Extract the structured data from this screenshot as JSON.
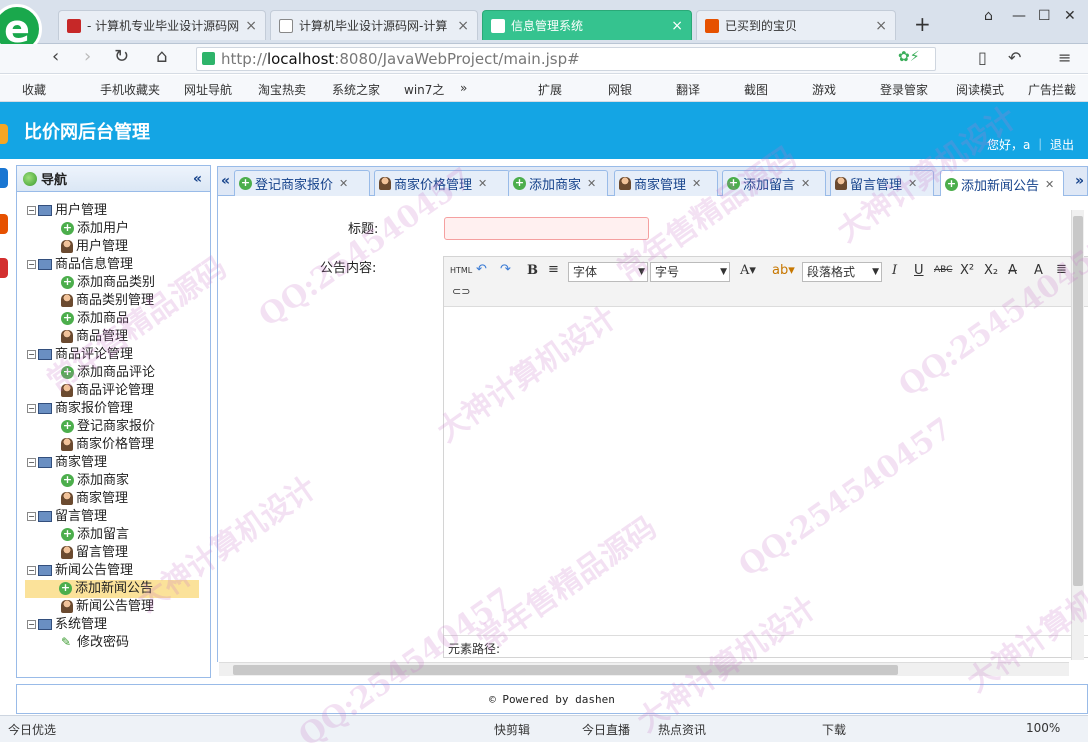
{
  "browser": {
    "tabs": [
      {
        "label": "- 计算机专业毕业设计源码网",
        "close": "×"
      },
      {
        "label": "计算机毕业设计源码网-计算",
        "close": "×"
      },
      {
        "label": "信息管理系统",
        "close": "×"
      },
      {
        "label": "已买到的宝贝",
        "close": "×"
      }
    ],
    "new_tab": "+",
    "url_prefix": "http://",
    "url_host": "localhost",
    "url_rest": ":8080/JavaWebProject/main.jsp#",
    "bookmarks": [
      "收藏",
      "手机收藏夹",
      "网址导航",
      "淘宝热卖",
      "系统之家",
      "win7之",
      "»",
      "扩展",
      "网银",
      "翻译",
      "截图",
      "游戏",
      "登录管家",
      "阅读模式",
      "广告拦截"
    ]
  },
  "app": {
    "title": "比价网后台管理",
    "welcome": "您好，a ｜ 退出"
  },
  "nav": {
    "title": "导航",
    "collapse": "«",
    "groups": [
      {
        "label": "用户管理",
        "items": [
          "添加用户",
          "用户管理"
        ]
      },
      {
        "label": "商品信息管理",
        "items": [
          "添加商品类别",
          "商品类别管理",
          "添加商品",
          "商品管理"
        ]
      },
      {
        "label": "商品评论管理",
        "items": [
          "添加商品评论",
          "商品评论管理"
        ]
      },
      {
        "label": "商家报价管理",
        "items": [
          "登记商家报价",
          "商家价格管理"
        ]
      },
      {
        "label": "商家管理",
        "items": [
          "添加商家",
          "商家管理"
        ]
      },
      {
        "label": "留言管理",
        "items": [
          "添加留言",
          "留言管理"
        ]
      },
      {
        "label": "新闻公告管理",
        "items": [
          "添加新闻公告",
          "新闻公告管理"
        ]
      },
      {
        "label": "系统管理",
        "items": [
          "修改密码"
        ]
      }
    ],
    "selected": "添加新闻公告"
  },
  "content_tabs": [
    {
      "label": "登记商家报价"
    },
    {
      "label": "商家价格管理"
    },
    {
      "label": "添加商家"
    },
    {
      "label": "商家管理"
    },
    {
      "label": "添加留言"
    },
    {
      "label": "留言管理"
    },
    {
      "label": "添加新闻公告"
    }
  ],
  "form": {
    "title_label": "标题:",
    "content_label": "公告内容:",
    "title_value": "",
    "font_select": "字体",
    "size_select": "字号",
    "para_select": "段落格式",
    "path_label": "元素路径:"
  },
  "footer": "© Powered by dashen",
  "statusbar": [
    "今日优选",
    "快剪辑",
    "今日直播",
    "热点资讯",
    "下载",
    "100%"
  ],
  "watermark": [
    "QQ:254540457",
    "大神计算机设计",
    "常年售精品源码"
  ]
}
